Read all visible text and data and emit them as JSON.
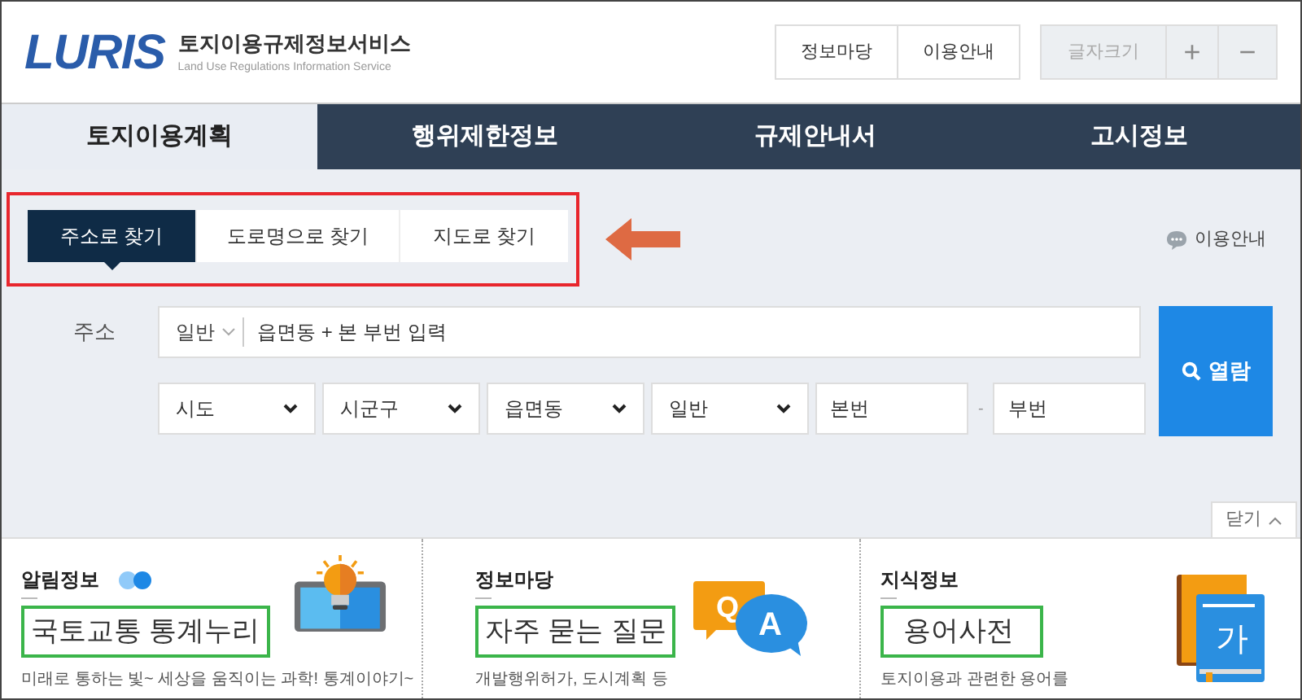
{
  "header": {
    "logo_text": "LURIS",
    "service_name": "토지이용규제정보서비스",
    "service_name_en": "Land Use Regulations Information Service",
    "links": [
      "정보마당",
      "이용안내"
    ],
    "font_size": {
      "label": "글자크기",
      "increase": "+",
      "decrease": "−"
    }
  },
  "nav": [
    {
      "label": "토지이용계획",
      "selected": true
    },
    {
      "label": "행위제한정보",
      "selected": false
    },
    {
      "label": "규제안내서",
      "selected": false
    },
    {
      "label": "고시정보",
      "selected": false
    }
  ],
  "search_tabs": [
    {
      "label": "주소로 찾기",
      "selected": true
    },
    {
      "label": "도로명으로 찾기",
      "selected": false
    },
    {
      "label": "지도로 찾기",
      "selected": false
    }
  ],
  "help_link": "이용안내",
  "address": {
    "label": "주소",
    "type_select": "일반",
    "placeholder": "읍면동 + 본 부번 입력"
  },
  "fields": [
    {
      "kind": "select",
      "value": "시도"
    },
    {
      "kind": "select",
      "value": "시군구"
    },
    {
      "kind": "select",
      "value": "읍면동"
    },
    {
      "kind": "select",
      "value": "일반"
    },
    {
      "kind": "input",
      "placeholder": "본번"
    },
    {
      "kind": "separator",
      "text": "-"
    },
    {
      "kind": "input",
      "placeholder": "부번"
    }
  ],
  "search_button": "열람",
  "close_button": "닫기",
  "panels": [
    {
      "heading": "알림정보",
      "pager": [
        {
          "selected": false
        },
        {
          "selected": true
        }
      ],
      "title": "국토교통 통계누리",
      "description": "미래로 통하는 빛~ 세상을 움직이는 과학! 통계이야기~",
      "kind": "bulb"
    },
    {
      "heading": "정보마당",
      "title": "자주 묻는 질문",
      "description": "개발행위허가, 도시계획 등",
      "kind": "qa",
      "icon_letters": [
        "Q",
        "A"
      ]
    },
    {
      "heading": "지식정보",
      "title": "용어사전",
      "description": "토지이용과 관련한 용어를",
      "kind": "book",
      "icon_letters": [
        "가"
      ]
    }
  ]
}
